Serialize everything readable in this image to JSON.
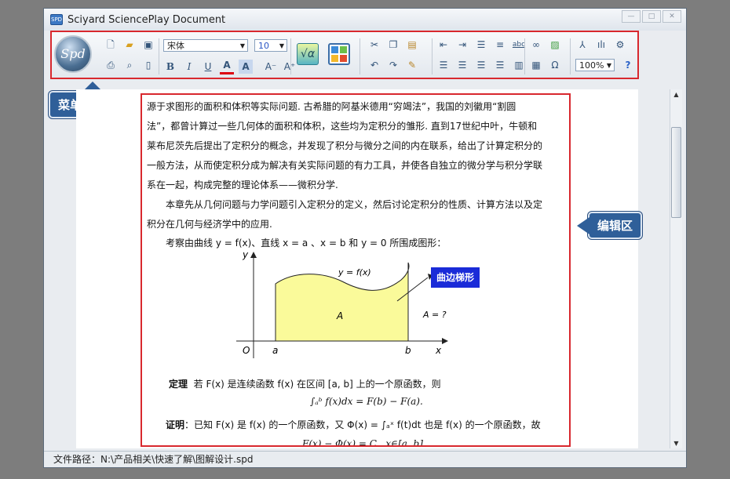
{
  "window": {
    "title": "Sciyard SciencePlay Document",
    "app_icon": "spd-icon"
  },
  "ribbon": {
    "logo": "Spd",
    "font_name": "宋体",
    "font_size": "10",
    "zoom": "100%",
    "icons_row1": [
      "new-doc-icon",
      "open-folder-icon",
      "save-icon",
      "cut-icon",
      "copy-icon",
      "paste-icon",
      "decrease-indent-icon",
      "increase-indent-icon",
      "bullets-icon",
      "line-spacing-icon",
      "spell-check-icon",
      "link-icon",
      "insert-image-icon",
      "symbol-tool-icon",
      "chart-tool-icon",
      "settings-icon"
    ],
    "icons_row2": [
      "print-icon",
      "print-preview-icon",
      "page-icon",
      "bold-icon",
      "italic-icon",
      "underline-icon",
      "font-color-icon",
      "highlight-icon",
      "font-grow-icon",
      "font-shrink-icon",
      "undo-icon",
      "redo-icon",
      "format-painter-icon",
      "align-left-icon",
      "align-center-icon",
      "align-right-icon",
      "justify-icon",
      "columns-icon",
      "table-icon",
      "omega-icon",
      "help-icon"
    ]
  },
  "callouts": {
    "menu": "菜单工具区",
    "edit": "编辑区"
  },
  "document": {
    "lines": [
      "源于求图形的面积和体积等实际问题. 古希腊的阿基米德用“穷竭法”，我国的刘徽用“割圆",
      "法”，都曾计算过一些几何体的面积和体积，这些均为定积分的雏形. 直到17世纪中叶，牛顿和",
      "莱布尼茨先后提出了定积分的概念，并发现了积分与微分之间的内在联系，给出了计算定积分的",
      "一般方法，从而使定积分成为解决有关实际问题的有力工具，并使各自独立的微分学与积分学联",
      "系在一起，构成完整的理论体系——微积分学.",
      "本章先从几何问题与力学问题引入定积分的定义，然后讨论定积分的性质、计算方法以及定",
      "积分在几何与经济学中的应用.",
      "考察由曲线 y = f(x)、直线 x = a 、x = b 和 y = 0 所围成图形："
    ],
    "figure": {
      "curve_label": "y = f(x)",
      "area_label": "A",
      "question": "A = ?",
      "tag": "曲边梯形",
      "x_axis": "x",
      "y_axis": "y",
      "origin": "O",
      "a": "a",
      "b": "b"
    },
    "theorem_title": "定理",
    "theorem_text": "若 F(x) 是连续函数 f(x) 在区间 [a, b] 上的一个原函数，则",
    "theorem_formula": "∫ₐᵇ f(x)dx = F(b) − F(a).",
    "proof_title": "证明",
    "proof_text": "：已知 F(x) 是 f(x) 的一个原函数，又 Φ(x) = ∫ₐˣ f(t)dt 也是 f(x) 的一个原函数，故",
    "proof_formula": "F(x) − Φ(x) = C , x∈[a, b]."
  },
  "status": {
    "path": "文件路径：N:\\产品相关\\快速了解\\图解设计.spd"
  }
}
